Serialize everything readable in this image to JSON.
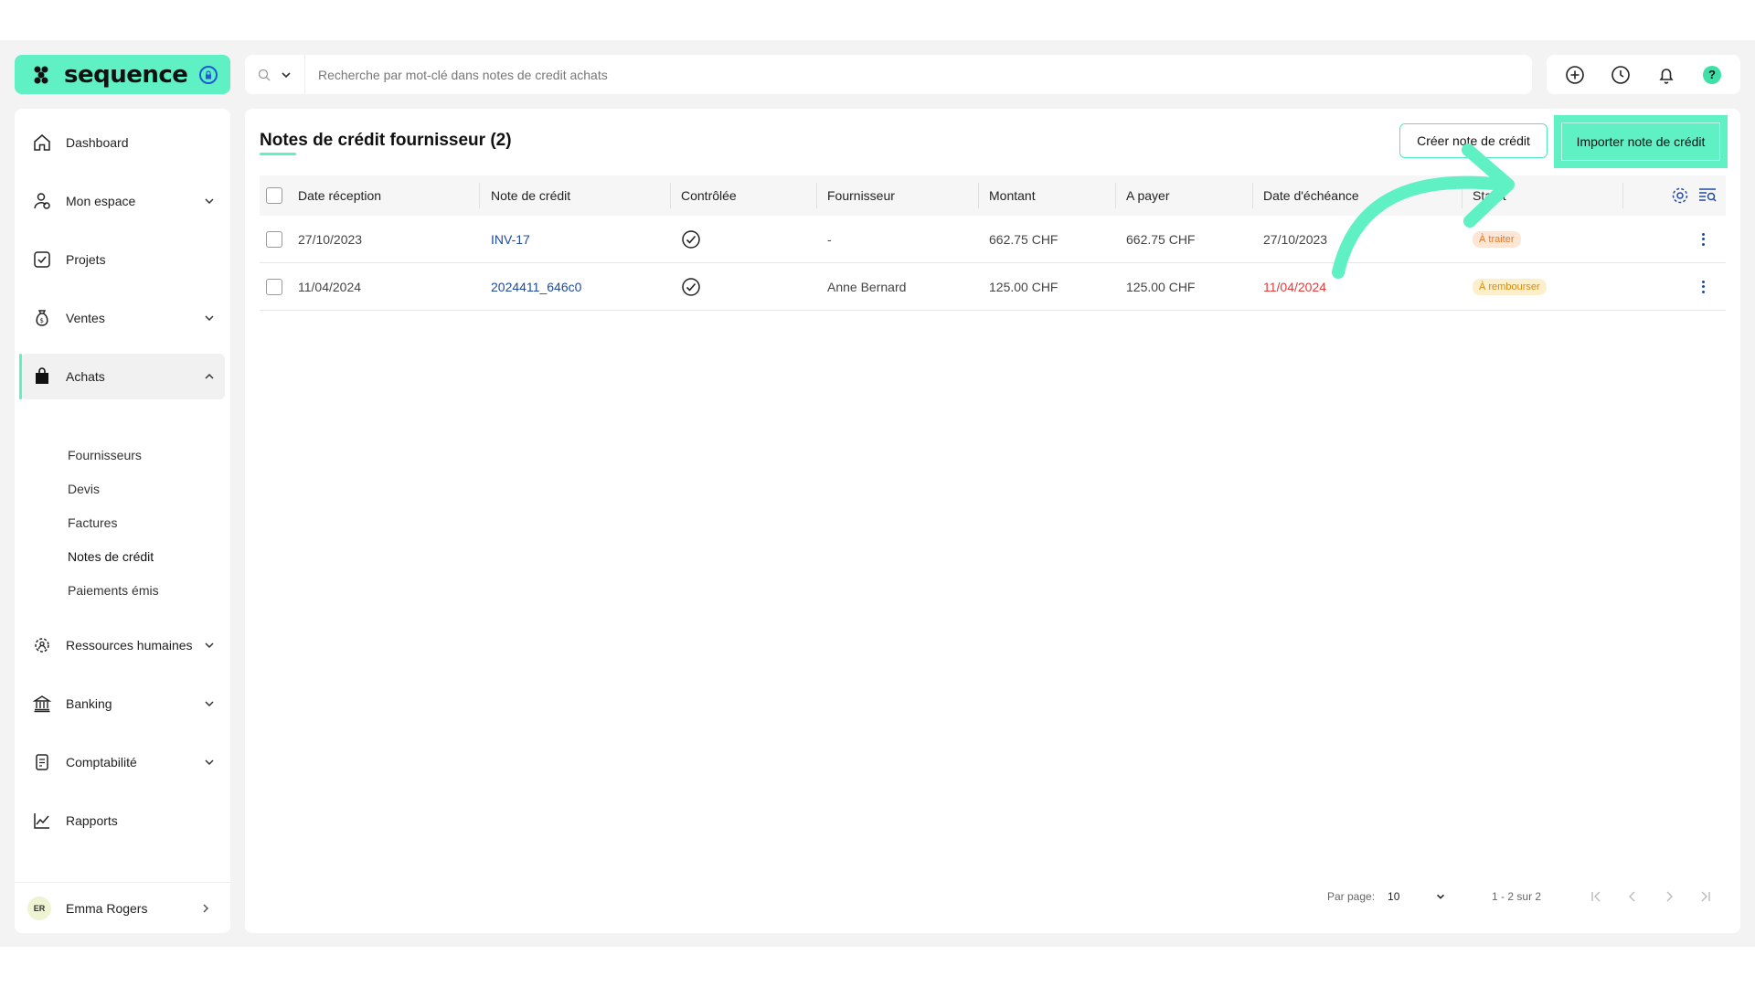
{
  "app": {
    "brand": "sequence"
  },
  "search": {
    "placeholder": "Recherche par mot-clé dans notes de credit achats"
  },
  "topbar": {
    "icons": [
      "plus-circle-icon",
      "clock-icon",
      "bell-icon",
      "help-icon"
    ],
    "help_label": "?"
  },
  "sidebar": {
    "items": [
      {
        "label": "Dashboard",
        "icon": "home-icon"
      },
      {
        "label": "Mon espace",
        "icon": "user-icon"
      },
      {
        "label": "Projets",
        "icon": "checkbox-icon"
      },
      {
        "label": "Ventes",
        "icon": "money-bag-icon"
      },
      {
        "label": "Achats",
        "icon": "shopping-bag-icon"
      },
      {
        "label": "Ressources humaines",
        "icon": "gear-people-icon"
      },
      {
        "label": "Banking",
        "icon": "bank-icon"
      },
      {
        "label": "Comptabilité",
        "icon": "ledger-icon"
      },
      {
        "label": "Rapports",
        "icon": "chart-icon"
      }
    ],
    "achats_sub": [
      "Fournisseurs",
      "Devis",
      "Factures",
      "Notes de crédit",
      "Paiements émis"
    ],
    "user": {
      "initials": "ER",
      "name": "Emma Rogers"
    }
  },
  "main": {
    "title": "Notes de crédit fournisseur (2)",
    "create_button": "Créer note de crédit",
    "import_button": "Importer note de crédit",
    "columns": [
      "Date réception",
      "Note de crédit",
      "Contrôlée",
      "Fournisseur",
      "Montant",
      "A payer",
      "Date d'échéance",
      "Statut"
    ],
    "rows": [
      {
        "date": "27/10/2023",
        "note": "INV-17",
        "supplier": "-",
        "amount": "662.75 CHF",
        "to_pay": "662.75 CHF",
        "due": "27/10/2023",
        "status": "À traiter"
      },
      {
        "date": "11/04/2024",
        "note": "2024411_646c0",
        "supplier": "Anne Bernard",
        "amount": "125.00 CHF",
        "to_pay": "125.00 CHF",
        "due": "11/04/2024",
        "status": "À rembourser"
      }
    ],
    "pagination": {
      "per_page_label": "Par page:",
      "per_page": "10",
      "range": "1 - 2 sur 2"
    }
  },
  "colors": {
    "accent": "#5ff0c4",
    "link": "#1f4aa0",
    "overdue": "#e23b3b"
  }
}
